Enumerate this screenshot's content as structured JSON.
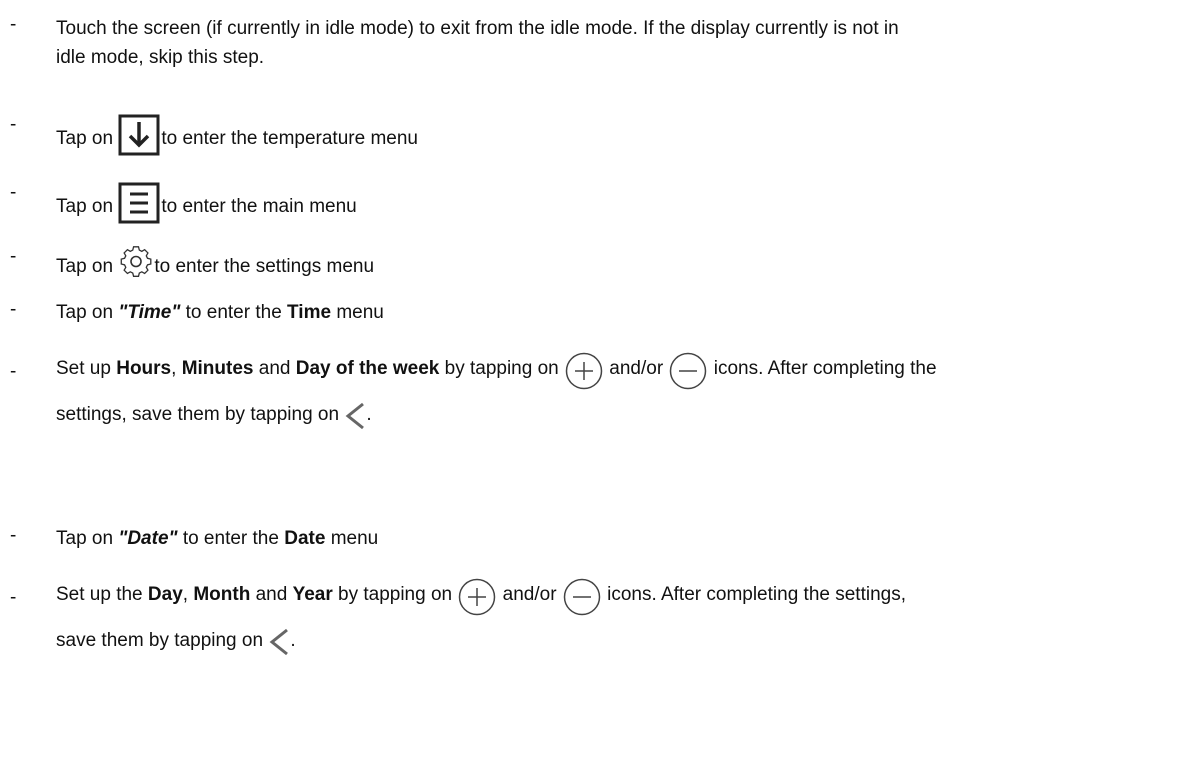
{
  "steps": [
    {
      "dash": "-",
      "line1": "Touch the screen (if currently in idle mode) to exit from the idle mode. If the display currently is not in",
      "line2": "idle mode, skip this step."
    },
    {
      "dash": "-",
      "pre": "Tap on",
      "icon": "arrow-down-box-icon",
      "post": "to enter the temperature menu"
    },
    {
      "dash": "-",
      "pre": "Tap on",
      "icon": "menu-box-icon",
      "post": "to enter the main menu"
    },
    {
      "dash": "-",
      "pre": "Tap on",
      "icon": "gear-icon",
      "post": "to enter the settings menu"
    },
    {
      "dash": "-",
      "pre": "Tap on",
      "quoted": "\"Time\"",
      "mid": "to enter the",
      "bold": "Time",
      "post": "menu"
    },
    {
      "dash": "-",
      "pre": "Set up",
      "b1": "Hours",
      "s1": ",",
      "b2": "Minutes",
      "s2": "and",
      "b3": "Day of the week",
      "s3": "by tapping on",
      "plus_icon": "plus-circle-icon",
      "s4": "and/or",
      "minus_icon": "minus-circle-icon",
      "s5": "icons. After completing the",
      "line2": "settings, save them by tapping on",
      "back_icon": "chevron-left-icon",
      "end": "."
    },
    {
      "dash": "-",
      "pre": "Tap on",
      "quoted": "\"Date\"",
      "mid": "to enter the",
      "bold": "Date",
      "post": "menu"
    },
    {
      "dash": "-",
      "pre": "Set up the",
      "b1": "Day",
      "s1": ",",
      "b2": "Month",
      "s2": "and",
      "b3": "Year",
      "s3": "by tapping on",
      "plus_icon": "plus-circle-icon",
      "s4": "and/or",
      "minus_icon": "minus-circle-icon",
      "s5": "icons. After completing the settings,",
      "line2": "save them by tapping on",
      "back_icon": "chevron-left-icon",
      "end": "."
    }
  ]
}
